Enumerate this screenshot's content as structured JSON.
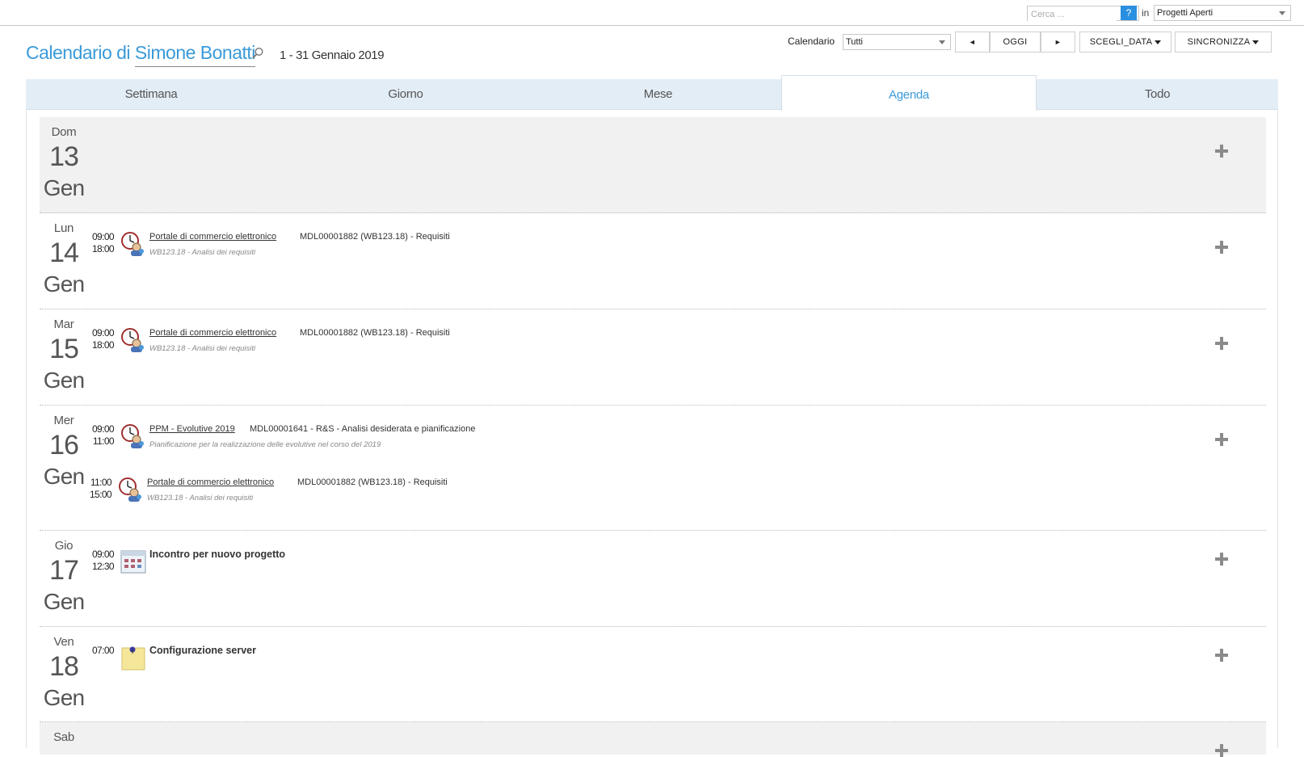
{
  "topbar": {
    "search_placeholder": "Cerca ...",
    "help_label": "?",
    "in_label": "in",
    "scope_value": "Progetti Aperti"
  },
  "header": {
    "title_prefix": "Calendario di",
    "user_name": "Simone Bonatti",
    "date_range": "1 - 31 Gennaio 2019",
    "calendar_label": "Calendario",
    "calendar_value": "Tutti",
    "prev_label": "◄",
    "today_label": "OGGI",
    "next_label": "►",
    "choose_date_label": "SCEGLI_DATA",
    "sync_label": "SINCRONIZZA"
  },
  "tabs": [
    {
      "label": "Settimana"
    },
    {
      "label": "Giorno"
    },
    {
      "label": "Mese"
    },
    {
      "label": "Agenda",
      "active": true
    },
    {
      "label": "Todo"
    }
  ],
  "days": [
    {
      "name": "Dom",
      "num": "13",
      "month": "Gen",
      "weekend": true,
      "events": []
    },
    {
      "name": "Lun",
      "num": "14",
      "month": "Gen",
      "events": [
        {
          "start": "09:00",
          "end": "18:00",
          "icon": "activity-clock-icon",
          "project": "Portale di commercio elettronico",
          "code": "MDL00001882 (WB123.18) - Requisiti",
          "detail": "WB123.18 - Analisi dei requisiti"
        }
      ]
    },
    {
      "name": "Mar",
      "num": "15",
      "month": "Gen",
      "events": [
        {
          "start": "09:00",
          "end": "18:00",
          "icon": "activity-clock-icon",
          "project": "Portale di commercio elettronico",
          "code": "MDL00001882 (WB123.18) - Requisiti",
          "detail": "WB123.18 - Analisi dei requisiti"
        }
      ]
    },
    {
      "name": "Mer",
      "num": "16",
      "month": "Gen",
      "events": [
        {
          "start": "09:00",
          "end": "11:00",
          "icon": "activity-clock-icon",
          "project": "PPM - Evolutive 2019",
          "code": "MDL00001641 - R&S - Analisi desiderata e pianificazione",
          "detail": "Pianificazione per la realizzazione delle evolutive nel corso del 2019"
        },
        {
          "start": "11:00",
          "end": "15:00",
          "icon": "activity-clock-icon",
          "project": "Portale di commercio elettronico",
          "code": "MDL00001882 (WB123.18) - Requisiti",
          "detail": "WB123.18 - Analisi dei requisiti"
        }
      ]
    },
    {
      "name": "Gio",
      "num": "17",
      "month": "Gen",
      "events": [
        {
          "start": "09:00",
          "end": "12:30",
          "icon": "calendar-meeting-icon",
          "title": "Incontro per nuovo progetto"
        }
      ]
    },
    {
      "name": "Ven",
      "num": "18",
      "month": "Gen",
      "events": [
        {
          "start": "07:00",
          "end": "",
          "icon": "sticky-note-icon",
          "title": "Configurazione server"
        }
      ]
    },
    {
      "name": "Sab",
      "num": "",
      "month": "",
      "weekend": true,
      "events": []
    }
  ]
}
